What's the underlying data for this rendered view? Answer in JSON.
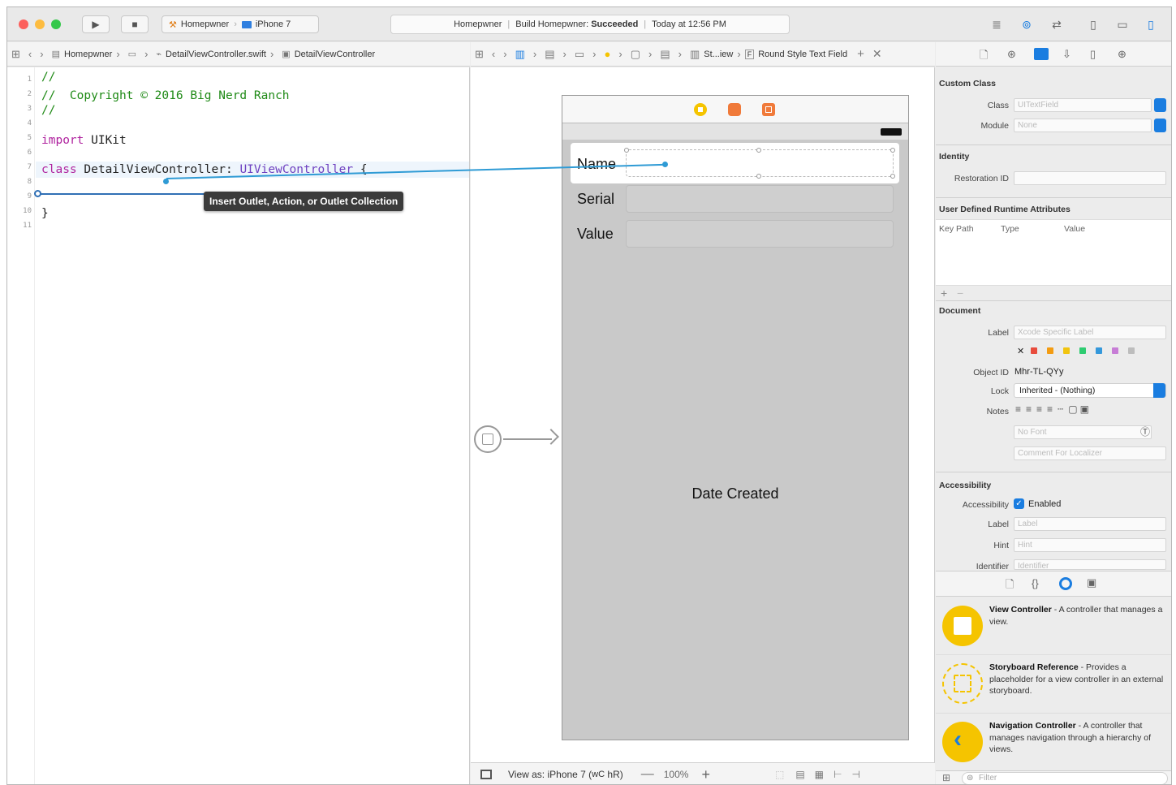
{
  "toolbar": {
    "scheme_project": "Homepwner",
    "scheme_device": "iPhone 7",
    "activity_project": "Homepwner",
    "activity_status_prefix": "Build Homepwner:",
    "activity_status": "Succeeded",
    "activity_time": "Today at 12:56 PM"
  },
  "editor_jumpbar": {
    "items": [
      "Homepwner",
      "DetailViewController.swift",
      "DetailViewController"
    ]
  },
  "canvas_jumpbar": {
    "items": [
      "St...iew",
      "F",
      "Round Style Text Field"
    ]
  },
  "code": {
    "line_numbers": [
      "1",
      "2",
      "3",
      "4",
      "5",
      "6",
      "7",
      "8",
      "9",
      "10",
      "11"
    ],
    "l1": "//",
    "l2": "//  Copyright © 2016 Big Nerd Ranch",
    "l3": "//",
    "l5_kw": "import",
    "l5_rest": " UIKit",
    "l7_kw": "class",
    "l7_name": " DetailViewController: ",
    "l7_type": "UIViewController",
    "l7_end": " {",
    "l10": "}"
  },
  "tooltip": "Insert Outlet, Action, or Outlet Collection",
  "scene": {
    "fields": [
      "Name",
      "Serial",
      "Value"
    ],
    "date_label": "Date Created"
  },
  "canvas_bottom": {
    "view_as": "View as: iPhone 7 (",
    "size_class": "wC",
    "size_class_2": "hR)",
    "zoom": "100%"
  },
  "inspector": {
    "custom_class": {
      "title": "Custom Class",
      "class_label": "Class",
      "class_placeholder": "UITextField",
      "module_label": "Module",
      "module_placeholder": "None"
    },
    "identity": {
      "title": "Identity",
      "restoration_label": "Restoration ID"
    },
    "runtime_attrs": {
      "title": "User Defined Runtime Attributes",
      "columns": [
        "Key Path",
        "Type",
        "Value"
      ]
    },
    "document": {
      "title": "Document",
      "label_label": "Label",
      "label_placeholder": "Xcode Specific Label",
      "object_id_label": "Object ID",
      "object_id": "Mhr-TL-QYy",
      "lock_label": "Lock",
      "lock_value": "Inherited - (Nothing)",
      "notes_label": "Notes",
      "font_placeholder": "No Font",
      "comment_placeholder": "Comment For Localizer",
      "swatch_colors": [
        "#e84c3d",
        "#f39c12",
        "#f1c40f",
        "#2ecc71",
        "#3498db",
        "#c77dd6",
        "#bdbdbd"
      ]
    },
    "accessibility": {
      "title": "Accessibility",
      "accessibility_label": "Accessibility",
      "enabled_label": "Enabled",
      "label_label": "Label",
      "label_placeholder": "Label",
      "hint_label": "Hint",
      "hint_placeholder": "Hint",
      "identifier_label": "Identifier",
      "identifier_placeholder": "Identifier"
    }
  },
  "library": [
    {
      "title": "View Controller",
      "desc": " - A controller that manages a view."
    },
    {
      "title": "Storyboard Reference",
      "desc": " - Provides a placeholder for a view controller in an external storyboard."
    },
    {
      "title": "Navigation Controller",
      "desc": " - A controller that manages navigation through a hierarchy of views."
    }
  ],
  "library_filter_placeholder": "Filter",
  "colors": {
    "accent": "#1a7de0",
    "connection_line": "#2f9bd5",
    "storyboard_yellow": "#f5c400"
  }
}
